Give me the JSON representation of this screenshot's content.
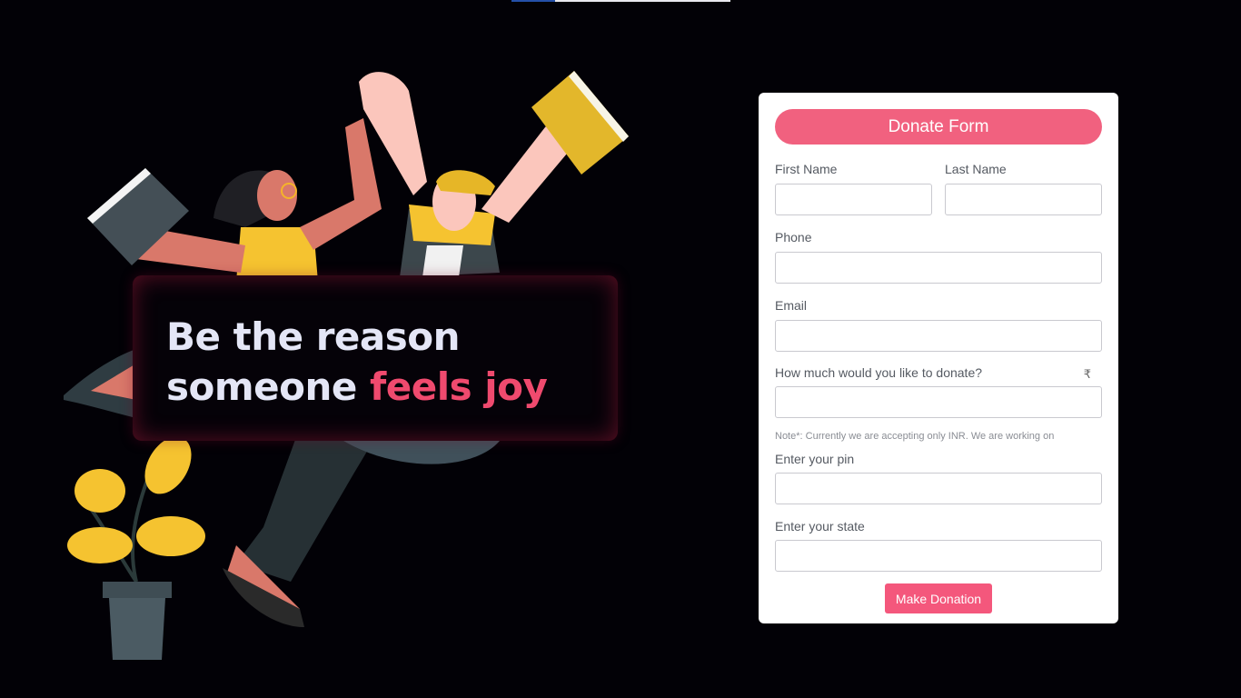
{
  "hero": {
    "line1": "Be the reason",
    "line2_plain": "someone",
    "line2_accent": "feels joy"
  },
  "colors": {
    "background": "#020106",
    "accent": "#ef4a6e",
    "button": "#f4577c",
    "title_bar": "#f1617f"
  },
  "form": {
    "title": "Donate Form",
    "first_name_label": "First Name",
    "first_name_value": "",
    "last_name_label": "Last Name",
    "last_name_value": "",
    "phone_label": "Phone",
    "phone_value": "",
    "email_label": "Email",
    "email_value": "",
    "amount_label": "How much would you like to donate?",
    "currency_symbol": "₹",
    "amount_value": "",
    "note": "Note*: Currently we are accepting only INR. We are working on",
    "pin_label": "Enter your pin",
    "pin_value": "",
    "state_label": "Enter your state",
    "state_value": "",
    "submit_label": "Make Donation"
  }
}
